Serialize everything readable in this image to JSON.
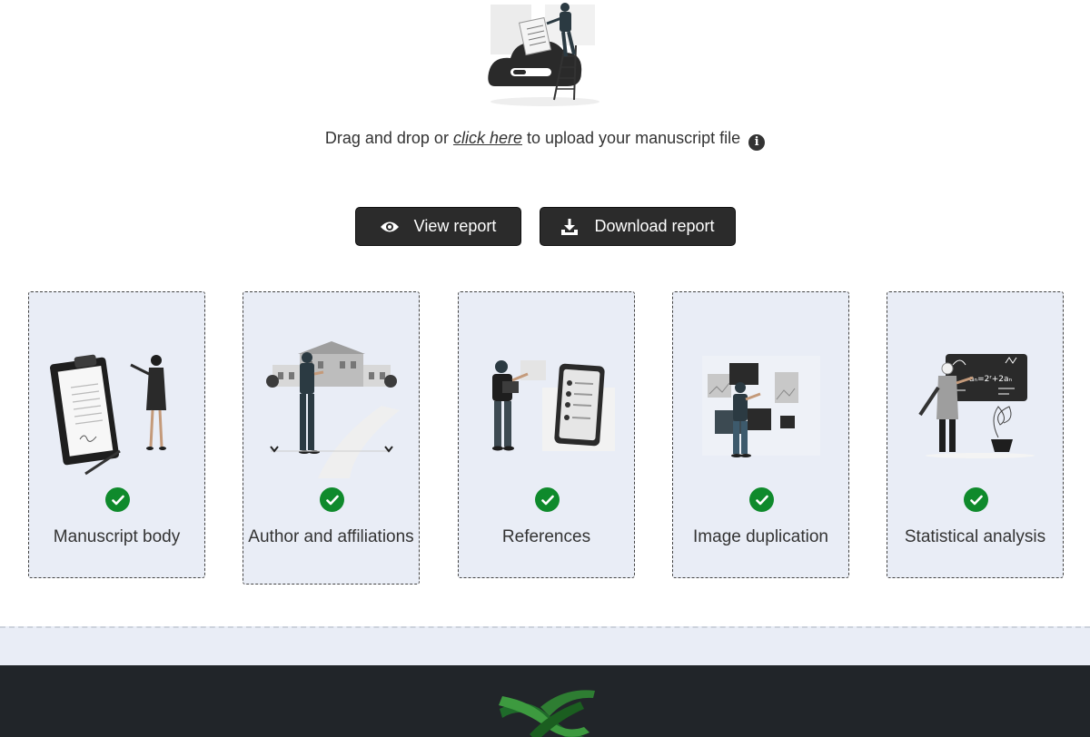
{
  "upload": {
    "prefix": "Drag and drop or ",
    "link": "click here",
    "suffix": " to upload your manuscript file",
    "info_icon": "info-icon"
  },
  "actions": {
    "view_label": "View report",
    "download_label": "Download report"
  },
  "cards": [
    {
      "label": "Manuscript body",
      "status": "complete"
    },
    {
      "label": "Author and affiliations",
      "status": "complete"
    },
    {
      "label": "References",
      "status": "complete"
    },
    {
      "label": "Image duplication",
      "status": "complete"
    },
    {
      "label": "Statistical analysis",
      "status": "complete"
    }
  ],
  "colors": {
    "button_bg": "#2b2b2b",
    "card_bg": "#e9edf6",
    "check_green": "#0f8a2c",
    "footer_bg": "#212529",
    "logo_green": "#2e7d32"
  }
}
